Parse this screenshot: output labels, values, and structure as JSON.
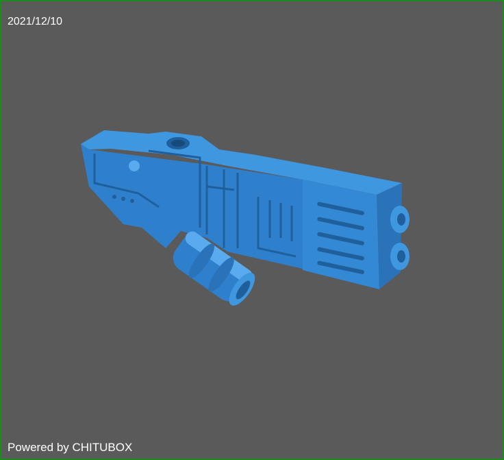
{
  "viewer": {
    "date": "2021/12/10",
    "footer": "Powered by CHITUBOX"
  },
  "colors": {
    "background": "#5a5a5a",
    "border": "#1c8a1c",
    "model_light": "#3a8fd8",
    "model_mid": "#2e7cc4",
    "model_dark": "#1f5f9c"
  },
  "model": {
    "name": "blaster-gun-model"
  }
}
